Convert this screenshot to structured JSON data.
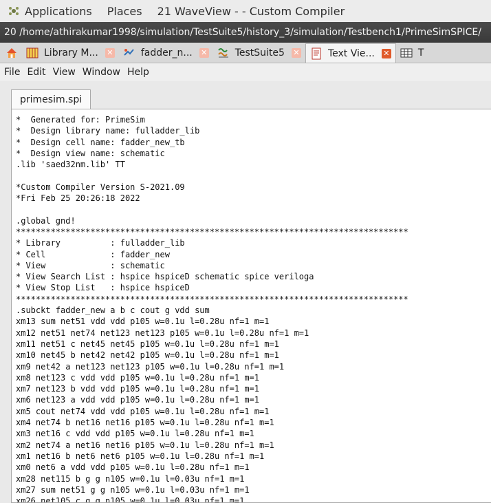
{
  "topbar": {
    "applications": "Applications",
    "places": "Places",
    "active_window": "21 WaveView -  - Custom Compiler"
  },
  "window": {
    "title": "20 /home/athirakumar1998/simulation/TestSuite5/history_3/simulation/Testbench1/PrimeSimSPICE/"
  },
  "tabs": [
    {
      "label": "Library M...",
      "icon": "library-manager-icon"
    },
    {
      "label": "fadder_n...",
      "icon": "schematic-icon"
    },
    {
      "label": "TestSuite5",
      "icon": "testsuite-icon"
    },
    {
      "label": "Text Vie...",
      "icon": "text-viewer-icon",
      "active": true
    },
    {
      "label": "T",
      "icon": "table-icon"
    }
  ],
  "menu": [
    "File",
    "Edit",
    "View",
    "Window",
    "Help"
  ],
  "document": {
    "filename": "primesim.spi",
    "lines": [
      "*  Generated for: PrimeSim",
      "*  Design library name: fulladder_lib",
      "*  Design cell name: fadder_new_tb",
      "*  Design view name: schematic",
      ".lib 'saed32nm.lib' TT",
      "",
      "*Custom Compiler Version S-2021.09",
      "*Fri Feb 25 20:26:18 2022",
      "",
      ".global gnd!",
      "*******************************************************************************",
      "* Library          : fulladder_lib",
      "* Cell             : fadder_new",
      "* View             : schematic",
      "* View Search List : hspice hspiceD schematic spice veriloga",
      "* View Stop List   : hspice hspiceD",
      "*******************************************************************************",
      ".subckt fadder_new a b c cout g vdd sum",
      "xm13 sum net51 vdd vdd p105 w=0.1u l=0.28u nf=1 m=1",
      "xm12 net51 net74 net123 net123 p105 w=0.1u l=0.28u nf=1 m=1",
      "xm11 net51 c net45 net45 p105 w=0.1u l=0.28u nf=1 m=1",
      "xm10 net45 b net42 net42 p105 w=0.1u l=0.28u nf=1 m=1",
      "xm9 net42 a net123 net123 p105 w=0.1u l=0.28u nf=1 m=1",
      "xm8 net123 c vdd vdd p105 w=0.1u l=0.28u nf=1 m=1",
      "xm7 net123 b vdd vdd p105 w=0.1u l=0.28u nf=1 m=1",
      "xm6 net123 a vdd vdd p105 w=0.1u l=0.28u nf=1 m=1",
      "xm5 cout net74 vdd vdd p105 w=0.1u l=0.28u nf=1 m=1",
      "xm4 net74 b net16 net16 p105 w=0.1u l=0.28u nf=1 m=1",
      "xm3 net16 c vdd vdd p105 w=0.1u l=0.28u nf=1 m=1",
      "xm2 net74 a net16 net16 p105 w=0.1u l=0.28u nf=1 m=1",
      "xm1 net16 b net6 net6 p105 w=0.1u l=0.28u nf=1 m=1",
      "xm0 net6 a vdd vdd p105 w=0.1u l=0.28u nf=1 m=1",
      "xm28 net115 b g g n105 w=0.1u l=0.03u nf=1 m=1",
      "xm27 sum net51 g g n105 w=0.1u l=0.03u nf=1 m=1",
      "xm26 net105 c g g n105 w=0.1u l=0.03u nf=1 m=1"
    ]
  }
}
